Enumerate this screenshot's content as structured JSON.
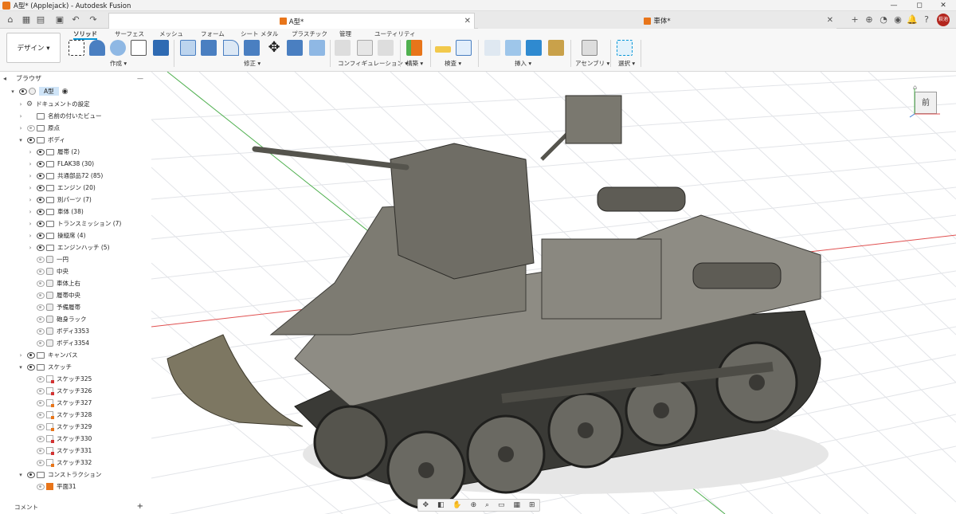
{
  "window": {
    "title": "A型* (Applejack) - Autodesk Fusion",
    "controls": [
      "—",
      "◻",
      "✕"
    ]
  },
  "tabs": {
    "documents": [
      {
        "label": "A型*",
        "active": true
      },
      {
        "label": "車体*",
        "active": false
      }
    ],
    "avatar_text": "萩池"
  },
  "ribbon": {
    "workspace": "デザイン ▾",
    "tabs": [
      "ソリッド",
      "サーフェス",
      "メッシュ",
      "フォーム",
      "シート メタル",
      "プラスチック",
      "管理",
      "ユーティリティ"
    ],
    "groups": [
      "作成 ▾",
      "修正 ▾",
      "コンフィギュレーション ▾",
      "構築 ▾",
      "検査 ▾",
      "挿入 ▾",
      "アセンブリ ▾",
      "選択 ▾"
    ]
  },
  "browser": {
    "title": "ブラウザ",
    "root": "A型",
    "items": [
      "ドキュメントの設定",
      "名前の付いたビュー",
      "原点",
      "ボディ",
      "履帯 (2)",
      "FLAK38 (30)",
      "共通部品72 (85)",
      "エンジン (20)",
      "別パーツ (7)",
      "車体 (38)",
      "トランスミッション (7)",
      "操縦席 (4)",
      "エンジンハッチ (5)",
      "一円",
      "中央",
      "車体上右",
      "履帯中央",
      "予備履帯",
      "砲身ラック",
      "ボディ3353",
      "ボディ3354",
      "キャンバス",
      "スケッチ",
      "スケッチ325",
      "スケッチ326",
      "スケッチ327",
      "スケッチ328",
      "スケッチ329",
      "スケッチ330",
      "スケッチ331",
      "スケッチ332",
      "コンストラクション",
      "平面31"
    ]
  },
  "comments": {
    "label": "コメント"
  },
  "viewcube": {
    "face": "前"
  },
  "colors": {
    "accent": "#0696d7",
    "brand": "#e8751a",
    "grid_red": "#e05050",
    "grid_green": "#4fb04f"
  }
}
